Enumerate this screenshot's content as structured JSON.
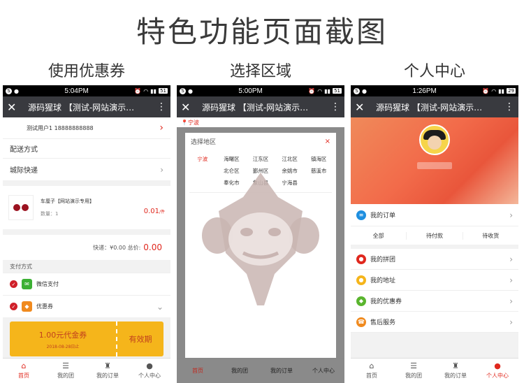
{
  "title": "特色功能页面截图",
  "captions": [
    "使用优惠券",
    "选择区域",
    "个人中心"
  ],
  "colors": {
    "accent": "#e0281e",
    "appbar": "#393a3f",
    "coupon": "#f5b51b"
  },
  "appbar": {
    "close_icon": "close-icon",
    "title": "源码猩球 【测试-网站演示…",
    "more_icon": "more-icon"
  },
  "phones": [
    {
      "time": "5:04PM",
      "battery": "51"
    },
    {
      "time": "5:00PM",
      "battery": "51"
    },
    {
      "time": "1:26PM",
      "battery": "29"
    }
  ],
  "tabs": [
    "首页",
    "我的团",
    "我的订单",
    "个人中心"
  ],
  "p1": {
    "user": "测试用户1 18888888888",
    "delivery_label": "配送方式",
    "delivery_value": "城际快递",
    "product_name": "车厘子【网站演示专用】",
    "quantity": "数量：1",
    "price": "0.01",
    "price_unit": "/件",
    "shipping": "快递：¥0.00 总价:",
    "total": "0.00",
    "pay_title": "支付方式",
    "wechat_pay": "微信支付",
    "coupon_label": "优惠券",
    "coupon_amount": "1.00元代金券",
    "coupon_date": "2018-08-28日止",
    "coupon_valid": "有效期"
  },
  "p2": {
    "city": "宁波",
    "dialog_title": "选择地区",
    "close": "×",
    "regions": [
      "宁波",
      "海曙区",
      "江东区",
      "江北区",
      "镇海区",
      "",
      "北仑区",
      "鄞州区",
      "余姚市",
      "慈溪市",
      "",
      "奉化市",
      "象山县",
      "宁海县",
      ""
    ]
  },
  "p3": {
    "my_order": "我的订单",
    "order_tabs": [
      "全部",
      "待付款",
      "待收货"
    ],
    "menu": [
      {
        "label": "我的拼团",
        "icon": "group-icon",
        "color": "#e0281e"
      },
      {
        "label": "我的地址",
        "icon": "location-icon",
        "color": "#f5b51b"
      },
      {
        "label": "我的优惠券",
        "icon": "coupon-icon",
        "color": "#5ab52e"
      },
      {
        "label": "售后服务",
        "icon": "service-icon",
        "color": "#f08a1e"
      }
    ]
  }
}
